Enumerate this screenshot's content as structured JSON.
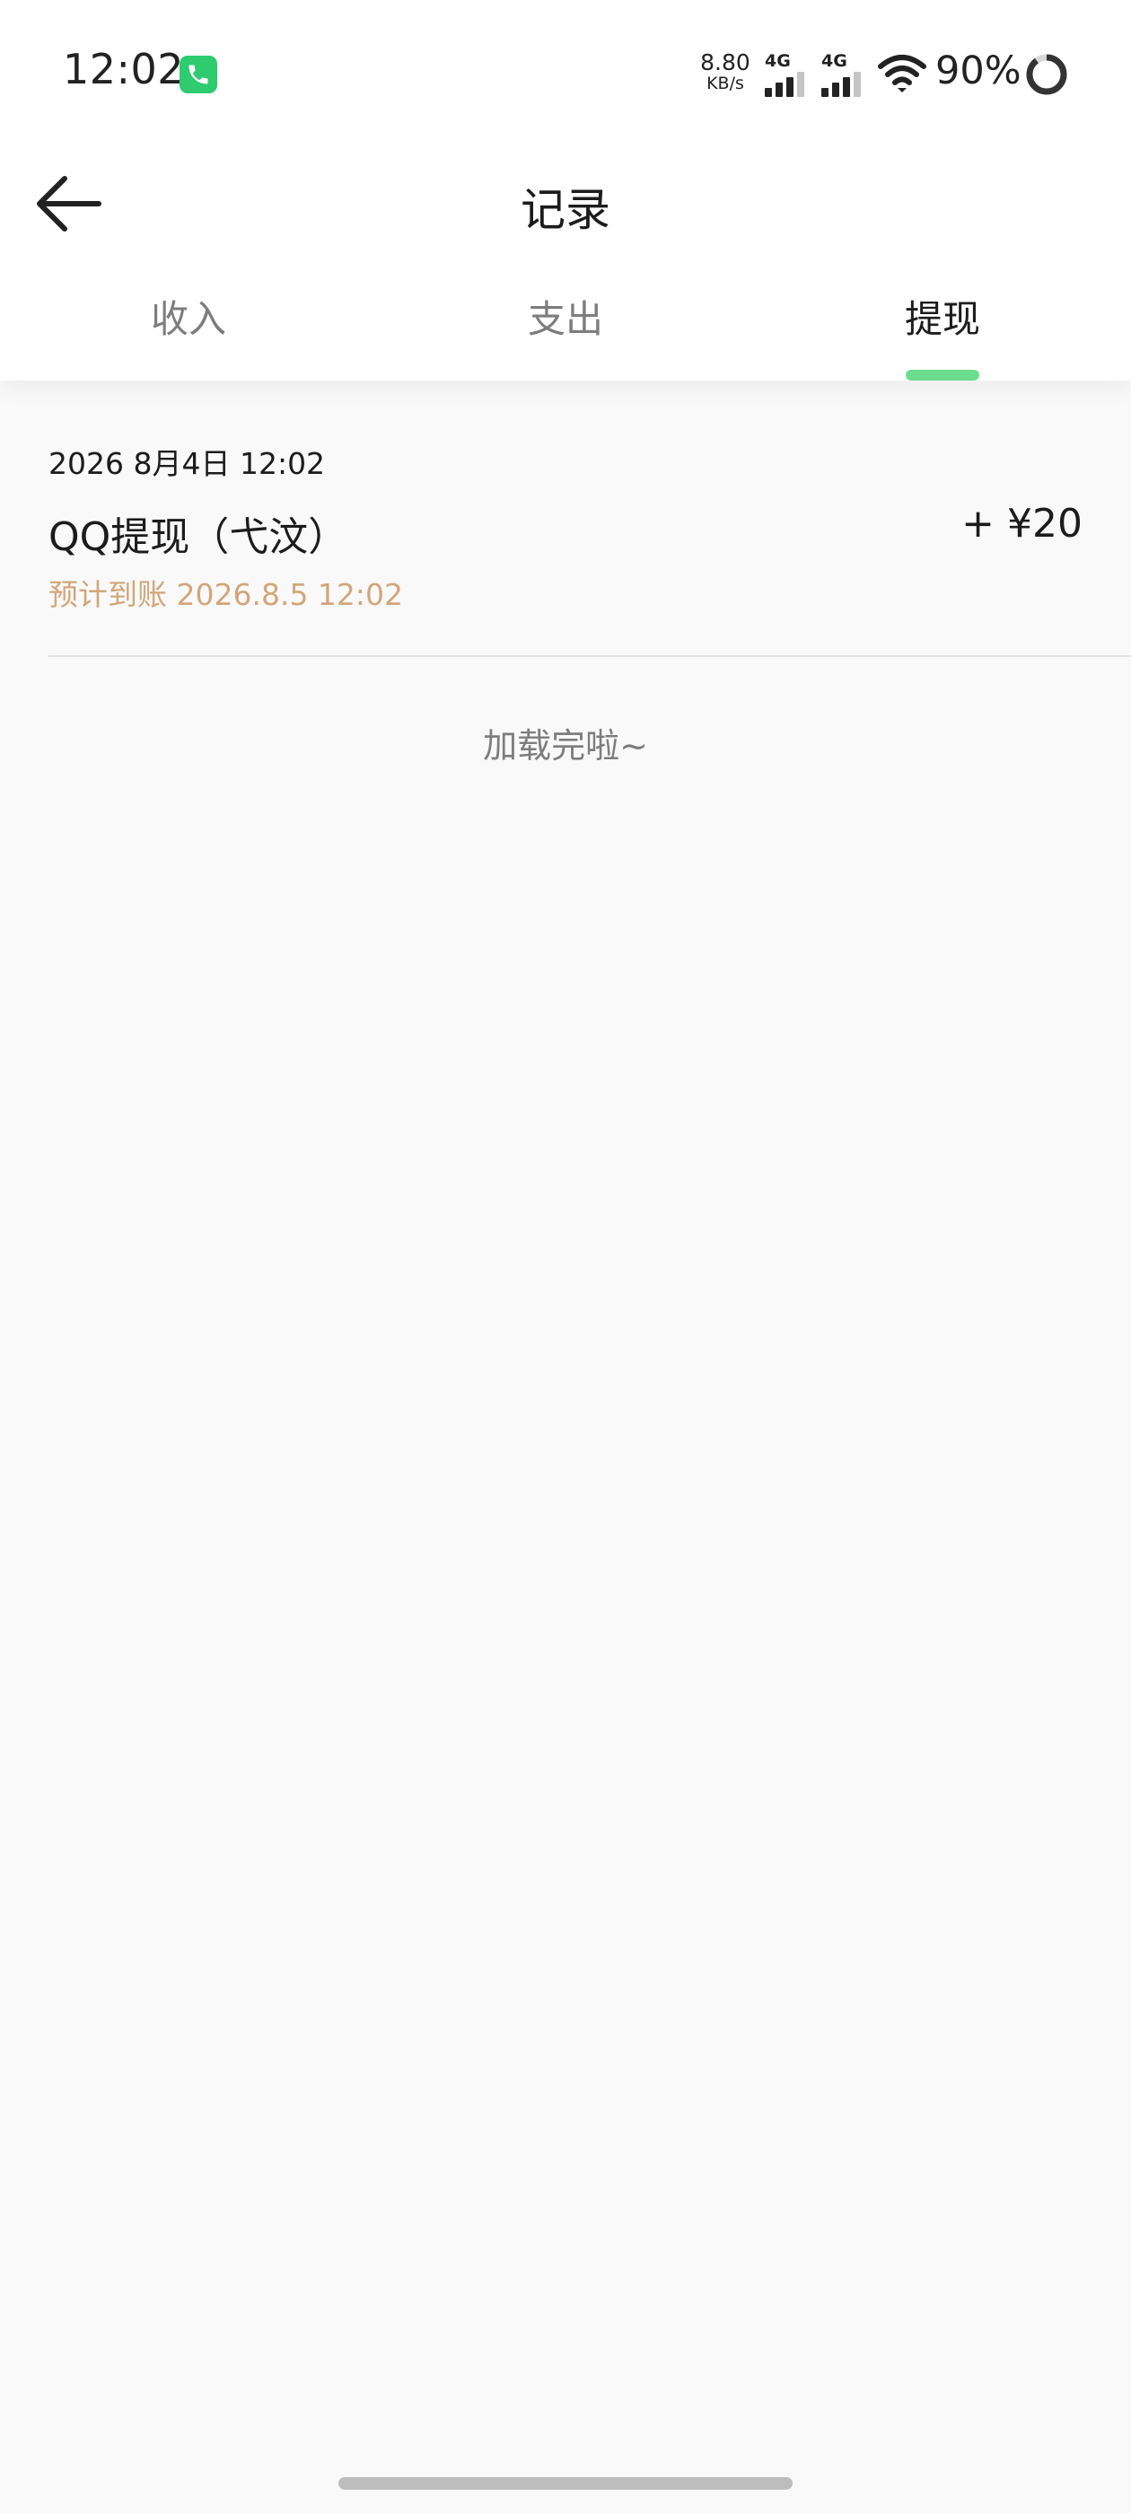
{
  "status_bar": {
    "time": "12:02",
    "net_speed_value": "8.80",
    "net_speed_unit": "KB/s",
    "signal_1_label": "4G",
    "signal_2_label": "4G",
    "battery_text": "90%",
    "call_badge_color": "#2ecb6f"
  },
  "header": {
    "title": "记录",
    "back_icon": "arrow-left-icon"
  },
  "tabs": {
    "items": [
      {
        "label": "收入"
      },
      {
        "label": "支出"
      },
      {
        "label": "提现"
      }
    ],
    "active": "提现",
    "indicator_color": "#6cdc8e"
  },
  "records": [
    {
      "date": "2026 8月4日 12:02",
      "name": "QQ提现（弋汶）",
      "amount": "+ ¥20",
      "eta": "预计到账 2026.8.5 12:02"
    }
  ],
  "footer": {
    "loaded_text": "加载完啦~"
  },
  "colors": {
    "accent": "#6cdc8e",
    "eta": "#d2a77a",
    "background": "#f9f9f9"
  }
}
